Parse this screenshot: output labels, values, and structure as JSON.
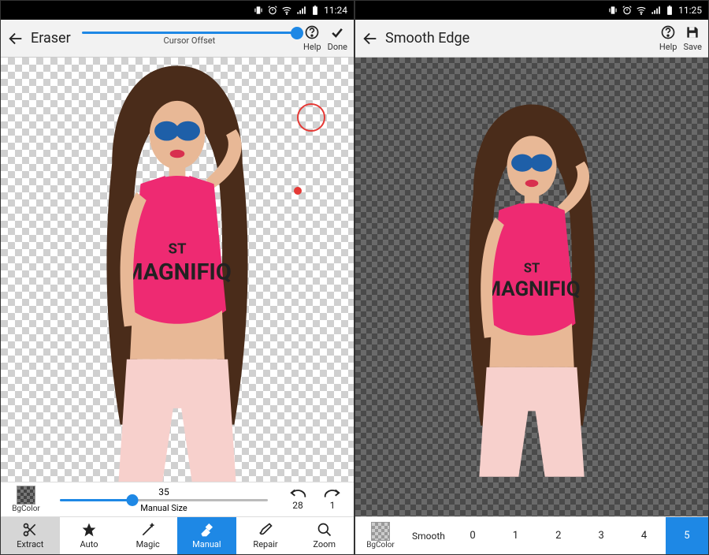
{
  "left": {
    "status": {
      "time": "11:24"
    },
    "appbar": {
      "title": "Eraser",
      "cursor_offset_label": "Cursor Offset",
      "actions": {
        "help": "Help",
        "done": "Done"
      }
    },
    "manual": {
      "bgcolor_label": "BgColor",
      "size_value": "35",
      "size_label": "Manual Size",
      "undo_count": "28",
      "redo_count": "1"
    },
    "toolbar": {
      "extract": "Extract",
      "auto": "Auto",
      "magic": "Magic",
      "manual": "Manual",
      "repair": "Repair",
      "zoom": "Zoom"
    },
    "subject": {
      "shirt_text_1": "ST",
      "shirt_text_2": "MAGNIFIQ"
    }
  },
  "right": {
    "status": {
      "time": "11:25"
    },
    "appbar": {
      "title": "Smooth Edge",
      "actions": {
        "help": "Help",
        "save": "Save"
      }
    },
    "smooth": {
      "bgcolor_label": "BgColor",
      "label": "Smooth",
      "steps": [
        "0",
        "1",
        "2",
        "3",
        "4",
        "5"
      ],
      "active_index": 5
    },
    "subject": {
      "shirt_text_1": "ST",
      "shirt_text_2": "MAGNIFIQ"
    }
  }
}
